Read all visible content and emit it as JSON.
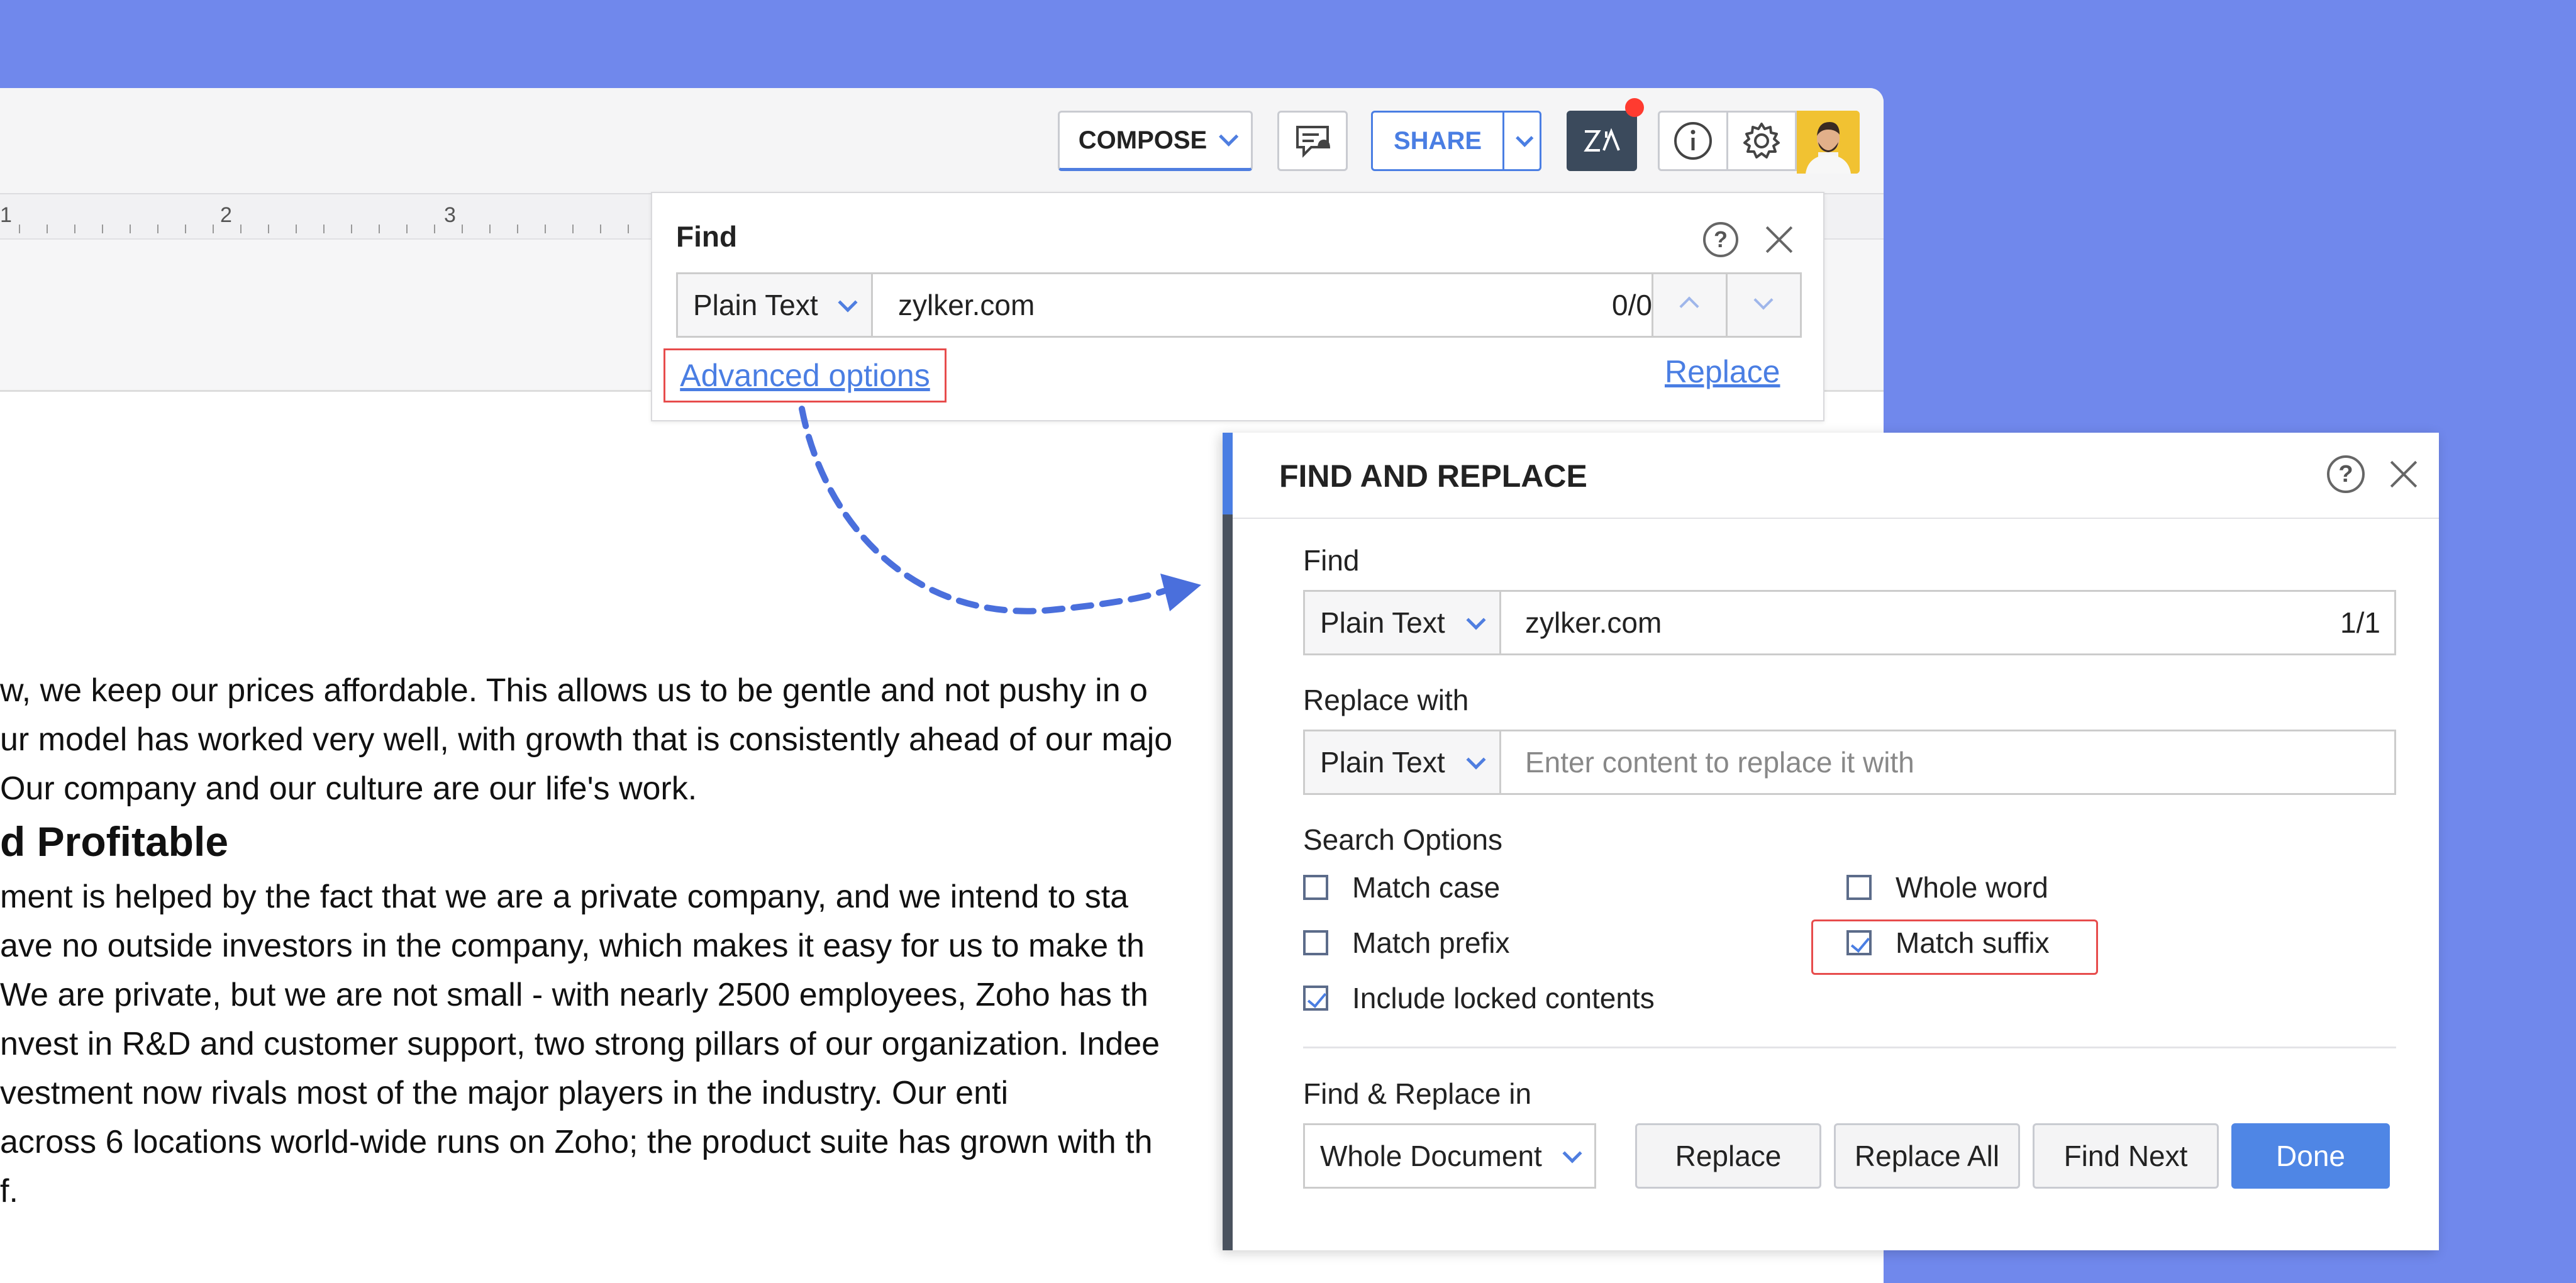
{
  "toolbar": {
    "compose_label": "COMPOSE",
    "share_label": "SHARE",
    "zia_label": "Zia"
  },
  "ruler": {
    "marks": [
      "1",
      "2",
      "3"
    ]
  },
  "document": {
    "lines": [
      "w, we keep our prices affordable. This allows us to be gentle and not pushy in o",
      "ur model has worked very well, with growth that is consistently ahead of our majo",
      "Our company and our culture are our life's work."
    ],
    "heading": "d Profitable",
    "lines2": [
      "ment is helped by the fact that we are a private company, and we intend to sta",
      "ave no outside investors in the company, which makes it easy for us to make th",
      " We are private, but we are not small - with nearly 2500 employees, Zoho has th",
      "nvest in R&D and customer support, two strong pillars of our organization. Indee",
      "vestment now rivals most of the major players in the industry. Our enti",
      "across 6 locations world-wide runs on Zoho; the product suite has grown with th",
      "f."
    ]
  },
  "find_bar": {
    "title": "Find",
    "mode": "Plain Text",
    "query": "zylker.com",
    "count": "0/0",
    "advanced_label": "Advanced options",
    "replace_label": "Replace",
    "help_glyph": "?"
  },
  "dialog": {
    "title": "FIND AND REPLACE",
    "help_glyph": "?",
    "find_label": "Find",
    "find_mode": "Plain Text",
    "find_value": "zylker.com",
    "find_count": "1/1",
    "replace_label": "Replace with",
    "replace_mode": "Plain Text",
    "replace_placeholder": "Enter content to replace it with",
    "search_options_label": "Search Options",
    "options": {
      "match_case": "Match case",
      "whole_word": "Whole word",
      "match_prefix": "Match prefix",
      "match_suffix": "Match suffix",
      "include_locked": "Include locked contents"
    },
    "scope_label": "Find & Replace in",
    "scope_value": "Whole Document",
    "buttons": {
      "replace": "Replace",
      "replace_all": "Replace All",
      "find_next": "Find Next",
      "done": "Done"
    }
  },
  "colors": {
    "background": "#7088ec",
    "accent": "#4a7ee3",
    "highlight": "#e74c4c"
  }
}
